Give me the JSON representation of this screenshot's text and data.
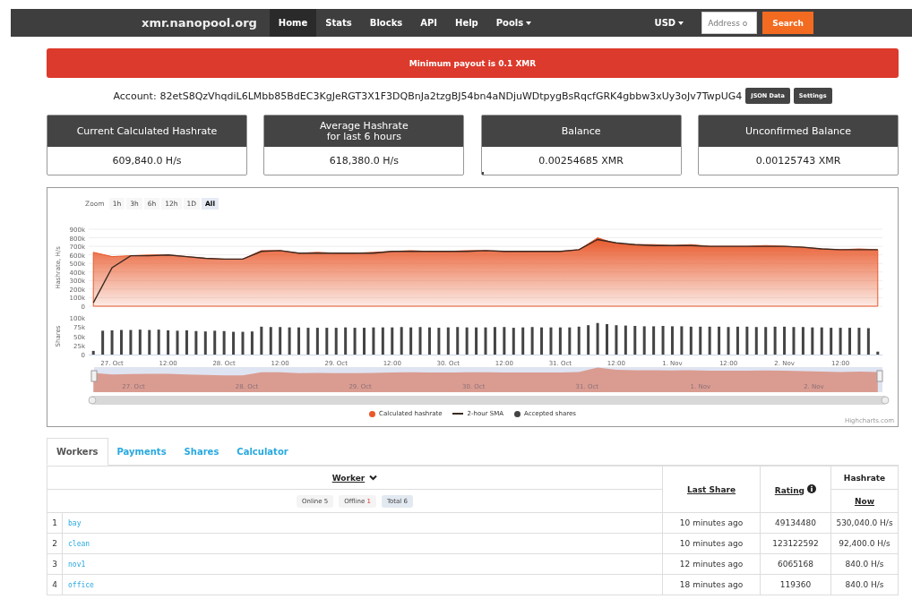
{
  "navbar": {
    "brand": "xmr.nanopool.org",
    "items": [
      {
        "label": "Home",
        "selected": true,
        "dropdown": false
      },
      {
        "label": "Stats",
        "selected": false,
        "dropdown": false
      },
      {
        "label": "Blocks",
        "selected": false,
        "dropdown": false
      },
      {
        "label": "API",
        "selected": false,
        "dropdown": false
      },
      {
        "label": "Help",
        "selected": false,
        "dropdown": false
      },
      {
        "label": "Pools",
        "selected": false,
        "dropdown": true
      }
    ],
    "currency": "USD",
    "search_placeholder": "Address o",
    "search_button": "Search"
  },
  "alert": "Minimum payout is 0.1 XMR",
  "account": {
    "label": "Account:",
    "address": "82etS8QzVhqdiL6LMbb85BdEC3KgJeRGT3X1F3DQBnJa2tzgBJ54bn4aNDjuWDtpygBsRqcfGRK4gbbw3xUy3oJv7TwpUG4",
    "buttons": [
      "JSON Data",
      "Settings"
    ]
  },
  "cards": [
    {
      "title": "Current Calculated Hashrate",
      "value": "609,840.0 H/s"
    },
    {
      "title": "Average Hashrate\nfor last 6 hours",
      "value": "618,380.0 H/s"
    },
    {
      "title": "Balance",
      "value": "0.00254685 XMR",
      "level": 0.01
    },
    {
      "title": "Unconfirmed Balance",
      "value": "0.00125743 XMR"
    }
  ],
  "chart": {
    "zoom_label": "Zoom",
    "zoom_buttons": [
      {
        "label": "1h",
        "selected": false
      },
      {
        "label": "3h",
        "selected": false
      },
      {
        "label": "6h",
        "selected": false
      },
      {
        "label": "12h",
        "selected": false
      },
      {
        "label": "1D",
        "selected": false
      },
      {
        "label": "All",
        "selected": true
      }
    ],
    "hashrate": {
      "chart_data": {
        "type": "area",
        "ylabel": "Hashrate, H/s",
        "grid": true,
        "ylim": [
          0,
          900000
        ],
        "yticks": [
          {
            "value": 0,
            "label": "0"
          },
          {
            "value": 100000,
            "label": "100k"
          },
          {
            "value": 200000,
            "label": "200k"
          },
          {
            "value": 300000,
            "label": "300k"
          },
          {
            "value": 400000,
            "label": "400k"
          },
          {
            "value": 500000,
            "label": "500k"
          },
          {
            "value": 600000,
            "label": "600k"
          },
          {
            "value": 700000,
            "label": "700k"
          },
          {
            "value": 800000,
            "label": "800k"
          },
          {
            "value": 900000,
            "label": "900k"
          }
        ],
        "categories": [
          null,
          null,
          null,
          null,
          null,
          null,
          null,
          null,
          null,
          null,
          null,
          null,
          null,
          null,
          null,
          null,
          null,
          null,
          null,
          null,
          null,
          null,
          null,
          null,
          null,
          null,
          null,
          null,
          null,
          null,
          null,
          null,
          null,
          null,
          null,
          null,
          null,
          null,
          null,
          null,
          null,
          null,
          null
        ],
        "series": [
          {
            "name": "Calculated hashrate",
            "type": "area",
            "color": "#e8582a",
            "values": [
              630000,
              580000,
              590000,
              600000,
              600000,
              580000,
              560000,
              550000,
              550000,
              650000,
              650000,
              620000,
              630000,
              620000,
              620000,
              630000,
              640000,
              650000,
              640000,
              640000,
              650000,
              650000,
              640000,
              640000,
              640000,
              640000,
              660000,
              800000,
              730000,
              720000,
              720000,
              710000,
              720000,
              700000,
              700000,
              700000,
              710000,
              700000,
              690000,
              670000,
              660000,
              670000,
              660000
            ]
          },
          {
            "name": "2-hour SMA",
            "type": "line",
            "color": "#3a2a22",
            "values": [
              40000,
              450000,
              590000,
              590000,
              600000,
              580000,
              560000,
              550000,
              550000,
              640000,
              650000,
              620000,
              620000,
              620000,
              620000,
              620000,
              640000,
              640000,
              640000,
              640000,
              640000,
              650000,
              640000,
              640000,
              640000,
              640000,
              660000,
              780000,
              740000,
              720000,
              710000,
              710000,
              710000,
              700000,
              700000,
              700000,
              700000,
              700000,
              690000,
              670000,
              660000,
              660000,
              660000
            ]
          }
        ]
      }
    },
    "shares": {
      "chart_data": {
        "type": "bar",
        "ylabel": "Shares",
        "ylim": [
          0,
          100000
        ],
        "yticks": [
          {
            "value": 0,
            "label": "0"
          },
          {
            "value": 25000,
            "label": "25k"
          },
          {
            "value": 50000,
            "label": "50k"
          },
          {
            "value": 75000,
            "label": "75k"
          },
          {
            "value": 100000,
            "label": "100k"
          }
        ],
        "categories": [
          null,
          null,
          "27. Oct",
          null,
          null,
          null,
          null,
          null,
          "12:00",
          null,
          null,
          null,
          null,
          null,
          "28. Oct",
          null,
          null,
          null,
          null,
          null,
          "12:00",
          null,
          null,
          null,
          null,
          null,
          "29. Oct",
          null,
          null,
          null,
          null,
          null,
          "12:00",
          null,
          null,
          null,
          null,
          null,
          "30. Oct",
          null,
          null,
          null,
          null,
          null,
          "12:00",
          null,
          null,
          null,
          null,
          null,
          "31. Oct",
          null,
          null,
          null,
          null,
          null,
          "12:00",
          null,
          null,
          null,
          null,
          null,
          "1. Nov",
          null,
          null,
          null,
          null,
          null,
          "12:00",
          null,
          null,
          null,
          null,
          null,
          "2. Nov",
          null,
          null,
          null,
          null,
          null,
          "12:00",
          null,
          null,
          null,
          null
        ],
        "series": [
          {
            "name": "Accepted shares",
            "color": "#444444",
            "values": [
              10000,
              65000,
              66000,
              67000,
              67000,
              68000,
              67000,
              68000,
              66000,
              65000,
              66000,
              64000,
              63000,
              65000,
              64000,
              62000,
              62000,
              63000,
              76000,
              75000,
              75000,
              74000,
              74000,
              73000,
              73000,
              73000,
              73000,
              74000,
              73000,
              73000,
              74000,
              74000,
              74000,
              75000,
              74000,
              75000,
              74000,
              73000,
              74000,
              75000,
              74000,
              74000,
              74000,
              75000,
              75000,
              73000,
              74000,
              75000,
              74000,
              74000,
              74000,
              74000,
              76000,
              80000,
              86000,
              83000,
              80000,
              79000,
              78000,
              77000,
              77000,
              78000,
              77000,
              77000,
              76000,
              76000,
              76000,
              76000,
              75000,
              76000,
              76000,
              75000,
              75000,
              76000,
              76000,
              75000,
              75000,
              74000,
              74000,
              73000,
              73000,
              73000,
              73000,
              72000,
              8000
            ]
          }
        ]
      }
    },
    "navigator_labels": [
      "27. Oct",
      "28. Oct",
      "29. Oct",
      "30. Oct",
      "31. Oct",
      "1. Nov",
      "2. Nov"
    ],
    "credit": "Highcharts.com"
  },
  "tabs": [
    {
      "label": "Workers",
      "selected": true
    },
    {
      "label": "Payments",
      "selected": false
    },
    {
      "label": "Shares",
      "selected": false
    },
    {
      "label": "Calculator",
      "selected": false
    }
  ],
  "table": {
    "worker_header": "Worker",
    "filters": [
      {
        "label": "Online",
        "count": "5",
        "selected": false,
        "alert": false
      },
      {
        "label": "Offline",
        "count": "1",
        "selected": false,
        "alert": true
      },
      {
        "label": "Total",
        "count": "6",
        "selected": true,
        "alert": false
      }
    ],
    "last_share_header": "Last Share",
    "rating_header": "Rating",
    "hashrate_header": "Hashrate",
    "hashrate_subheader": "Now",
    "rows": [
      {
        "index": "1",
        "worker": "bay",
        "last_share": "10 minutes ago",
        "rating": "49134480",
        "hashrate": "530,040.0 H/s"
      },
      {
        "index": "2",
        "worker": "clean",
        "last_share": "10 minutes ago",
        "rating": "123122592",
        "hashrate": "92,400.0 H/s"
      },
      {
        "index": "3",
        "worker": "nov1",
        "last_share": "12 minutes ago",
        "rating": "6065168",
        "hashrate": "840.0 H/s"
      },
      {
        "index": "4",
        "worker": "office",
        "last_share": "18 minutes ago",
        "rating": "119360",
        "hashrate": "840.0 H/s"
      }
    ]
  }
}
